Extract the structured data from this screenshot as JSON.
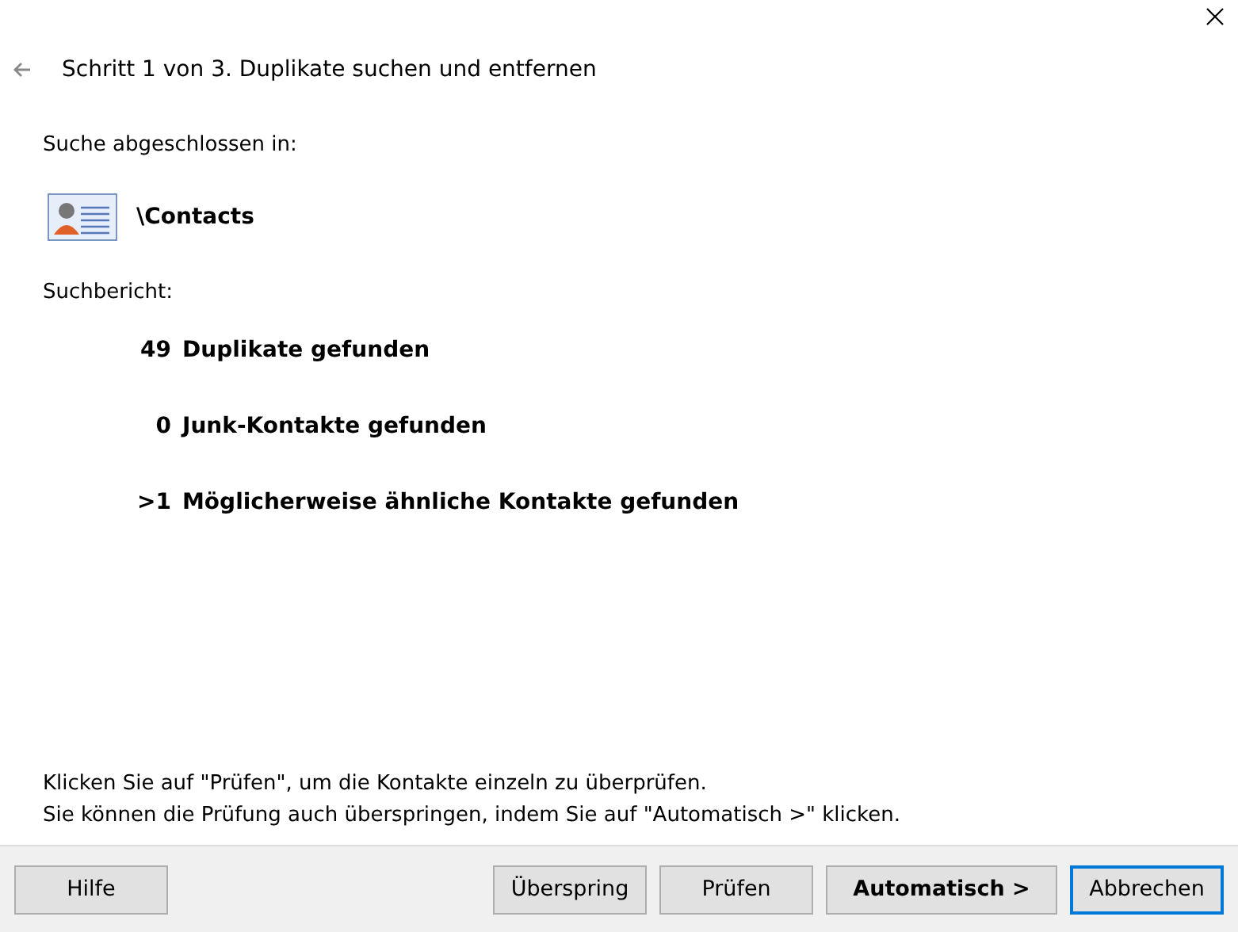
{
  "header": {
    "title": "Schritt 1 von 3. Duplikate suchen und entfernen"
  },
  "search": {
    "label": "Suche abgeschlossen in:",
    "folder": "\\Contacts"
  },
  "report": {
    "label": "Suchbericht:",
    "results": [
      {
        "count": "49",
        "text": "Duplikate gefunden"
      },
      {
        "count": "0",
        "text": "Junk-Kontakte gefunden"
      },
      {
        "count": ">1",
        "text": "Möglicherweise ähnliche Kontakte gefunden"
      }
    ]
  },
  "instructions": [
    "Klicken Sie auf \"Prüfen\", um die Kontakte einzeln zu überprüfen.",
    "Sie können die Prüfung auch überspringen, indem Sie auf \"Automatisch >\" klicken."
  ],
  "buttons": [
    {
      "label": "Hilfe",
      "kind": "normal"
    },
    {
      "label": "Überspring",
      "kind": "normal"
    },
    {
      "label": "Prüfen",
      "kind": "normal"
    },
    {
      "label": "Automatisch >",
      "kind": "default"
    },
    {
      "label": "Abbrechen",
      "kind": "focused"
    }
  ]
}
